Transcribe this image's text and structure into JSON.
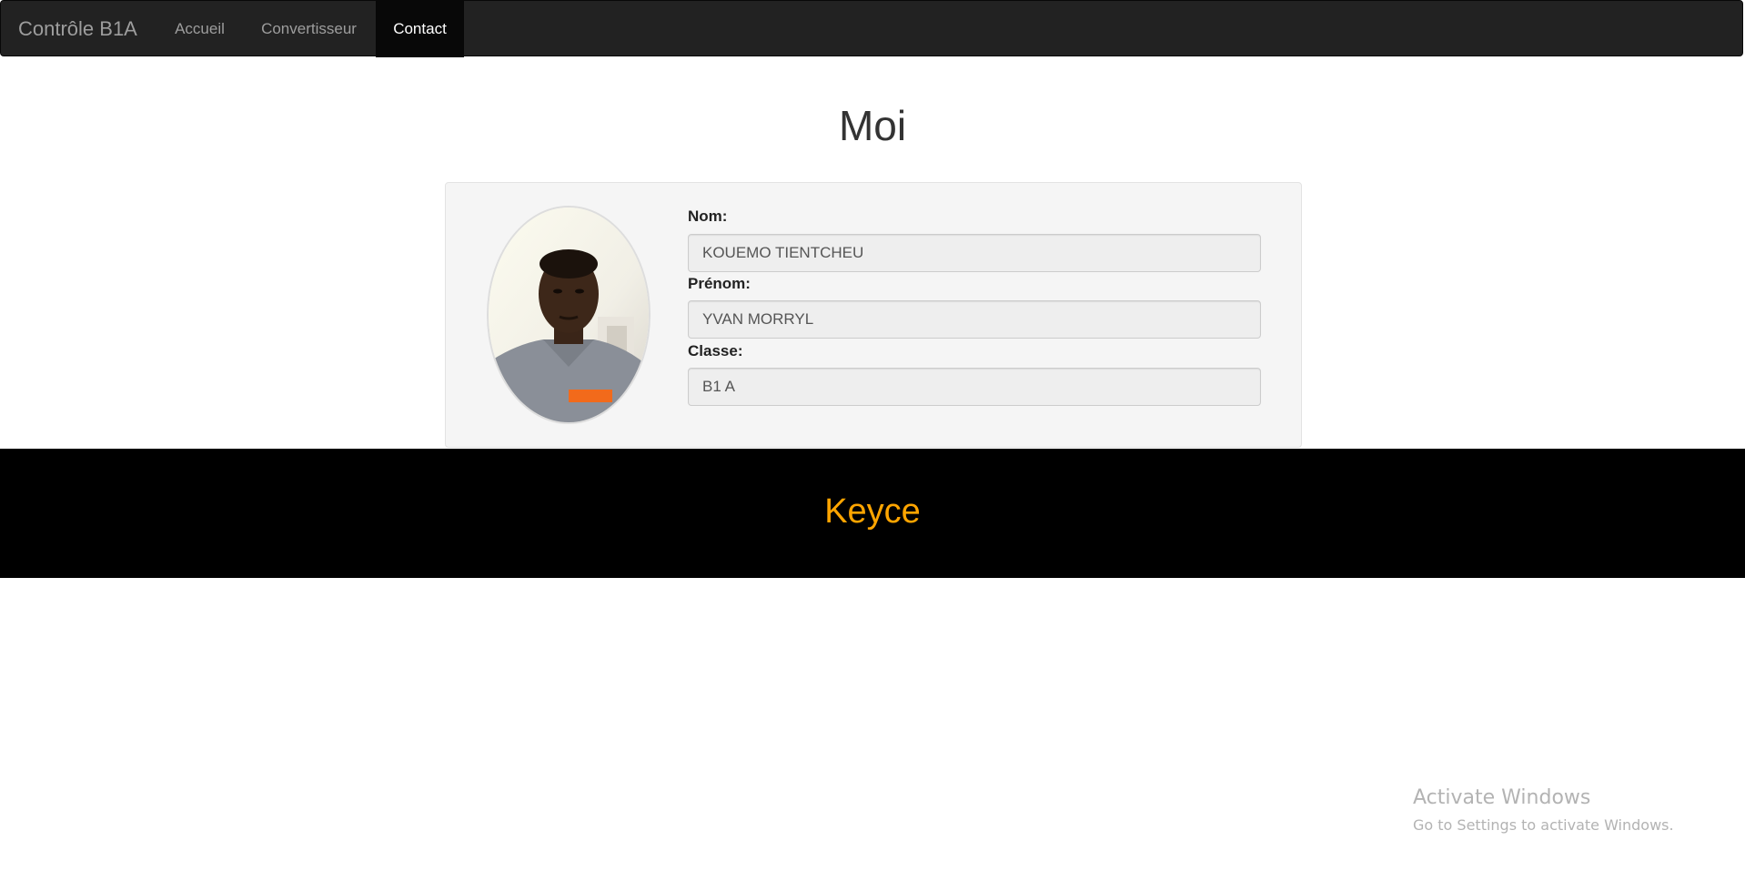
{
  "navbar": {
    "brand": "Contrôle B1A",
    "items": [
      {
        "label": "Accueil"
      },
      {
        "label": "Convertisseur"
      },
      {
        "label": "Contact",
        "active": true
      }
    ]
  },
  "main": {
    "title": "Moi",
    "profile": {
      "photo_icon": "user-photo",
      "fields": [
        {
          "label": "Nom:",
          "value": "KOUEMO TIENTCHEU"
        },
        {
          "label": "Prénom:",
          "value": "YVAN MORRYL"
        },
        {
          "label": "Classe:",
          "value": "B1 A"
        }
      ]
    }
  },
  "footer": {
    "title": "Keyce",
    "color": "#ffa500"
  },
  "watermark": {
    "title": "Activate Windows",
    "subtitle": "Go to Settings to activate Windows."
  },
  "colors": {
    "navbar_bg": "#222222",
    "nav_active_bg": "#080808",
    "card_bg": "#f5f5f5",
    "footer_bg": "#000000"
  }
}
